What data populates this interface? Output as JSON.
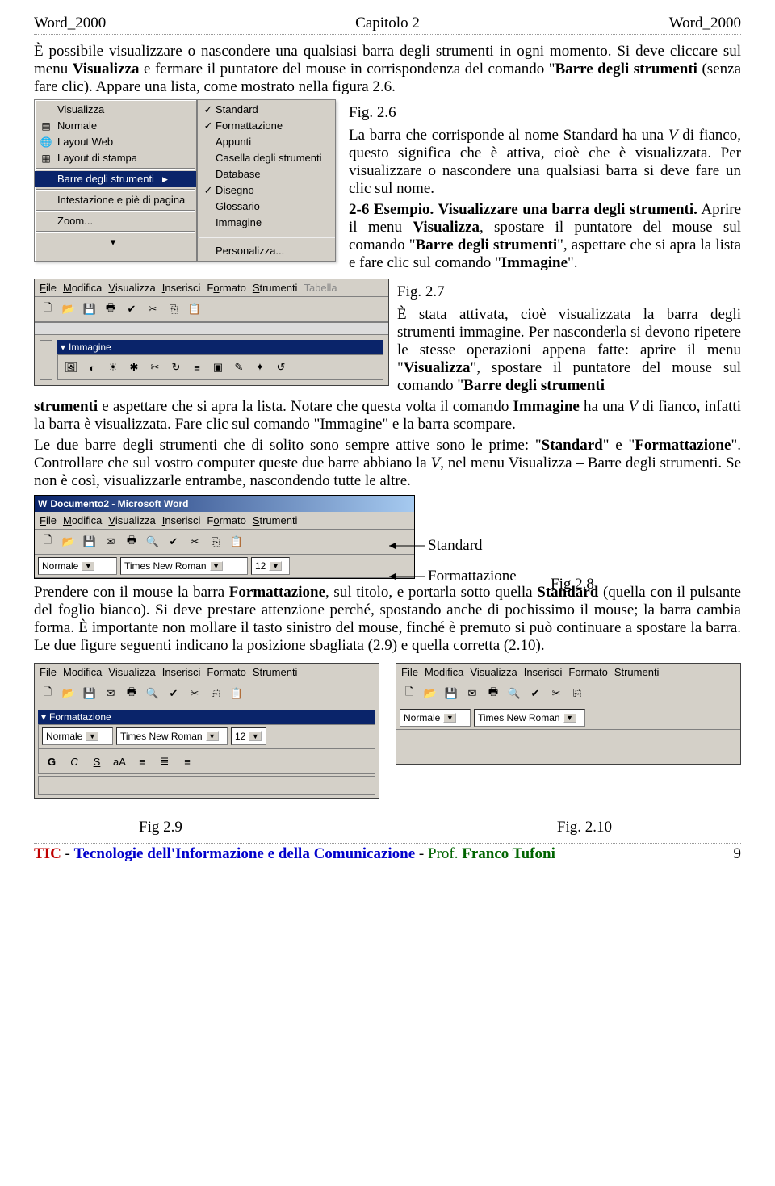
{
  "hdr": {
    "l": "Word_2000",
    "c": "Capitolo 2",
    "r": "Word_2000"
  },
  "p1": "È possibile visualizzare o nascondere una qualsiasi barra degli strumenti in ogni momento. Si deve cliccare sul menu ",
  "p1b": "Visualizza",
  "p1c": " e fermare il puntatore del mouse in corrispondenza del comando \"",
  "p1d": "Barre degli strumenti",
  "p1e": " (senza fare clic). Appare una lista, come mostrato nella figura 2.6.",
  "fig26": "Fig. 2.6",
  "p2a": "La barra che corrisponde al nome Standard ha una ",
  "p2b": "V",
  "p2c": " di fianco, questo significa che è attiva, cioè che è visualizzata. Per visualizzare o nascondere una qualsiasi barra si deve fare un clic sul nome.",
  "p3a": "2-6 Esempio.",
  "p3b": " Visualizzare una barra degli strumenti.",
  "p3c": " Aprire il menu ",
  "p3d": "Visualizza",
  "p3e": ", spostare il puntatore del mouse sul comando \"",
  "p3f": "Barre degli strumenti",
  "p3g": "\", aspettare che si apra la lista e fare clic sul comando \"",
  "p3h": "Immagine",
  "p3i": "\".",
  "menu1": {
    "items": [
      "Visualizza",
      "Normale",
      "Layout Web",
      "Layout di stampa"
    ],
    "hilite": "Barre degli strumenti",
    "next": [
      "Intestazione e piè di pagina",
      "Zoom..."
    ]
  },
  "sub": {
    "chk1": "Standard",
    "chk2": "Formattazione",
    "items": [
      "Appunti",
      "Casella degli strumenti",
      "Database"
    ],
    "chk3": "Disegno",
    "items2": [
      "Glossario",
      "Immagine"
    ],
    "last": "Personalizza..."
  },
  "fig27": "Fig. 2.7",
  "p4a": "È stata attivata, cioè visualizzata la barra degli strumenti immagine. Per nasconderla si devono ripetere le stesse operazioni appena fatte: aprire il menu \"",
  "p4b": "Visualizza",
  "p4c": "\", spostare il puntatore del mouse sul comando \"",
  "p4d": "Barre degli strumenti",
  "p4e": " e aspettare che si apra la lista. Notare che questa volta il comando ",
  "p4f": "Immagine",
  "p4g": " ha una ",
  "p4h": "V",
  "p4i": " di fianco, infatti la barra è visualizzata. Fare clic sul comando \"",
  "p4j": "Immagine",
  "p4k": "\" e la barra scompare.",
  "p5a": "Le due barre degli strumenti che di solito sono sempre attive sono le prime: \"",
  "p5b": "Standard",
  "p5c": "\" e \"",
  "p5d": "Formattazione",
  "p5e": "\". Controllare che sul vostro computer queste due barre abbiano la ",
  "p5f": "V",
  "p5g": ", nel menu Visualizza – Barre degli strumenti. Se non è così, visualizzarle entrambe, nascondendo tutte le altre.",
  "docTitle": "Documento2 - Microsoft Word",
  "mb": [
    "File",
    "Modifica",
    "Visualizza",
    "Inserisci",
    "Formato",
    "Strumenti",
    "Tabella"
  ],
  "imgTitle": "Immagine",
  "std": "Standard",
  "fmt": "Formattazione",
  "fig28": "Fig.2.8",
  "combo": {
    "style": "Normale",
    "font": "Times New Roman",
    "size": "12"
  },
  "p6a": "Prendere con il mouse la barra ",
  "p6b": "Formattazione",
  "p6c": ", sul titolo, e portarla sotto quella ",
  "p6d": "Standard",
  "p6e": " (quella con il pulsante del foglio bianco). Si deve prestare attenzione perché, spostando anche di pochissimo il mouse; la barra cambia forma. È importante non mollare il tasto sinistro del mouse, finché è premuto si può continuare a spostare la barra. Le due figure seguenti indicano la posizione sbagliata (2.9) e quella corretta (2.10).",
  "fmtTitle": "Formattazione",
  "fig29": "Fig 2.9",
  "fig210": "Fig. 2.10",
  "ft": {
    "tic": "TIC",
    "dash": " - ",
    "t2": "Tecnologie dell'Informazione e della Comunicazione",
    "sep": "  -  ",
    "prof": "Prof. ",
    "name": "Franco Tufoni",
    "pg": "9"
  }
}
